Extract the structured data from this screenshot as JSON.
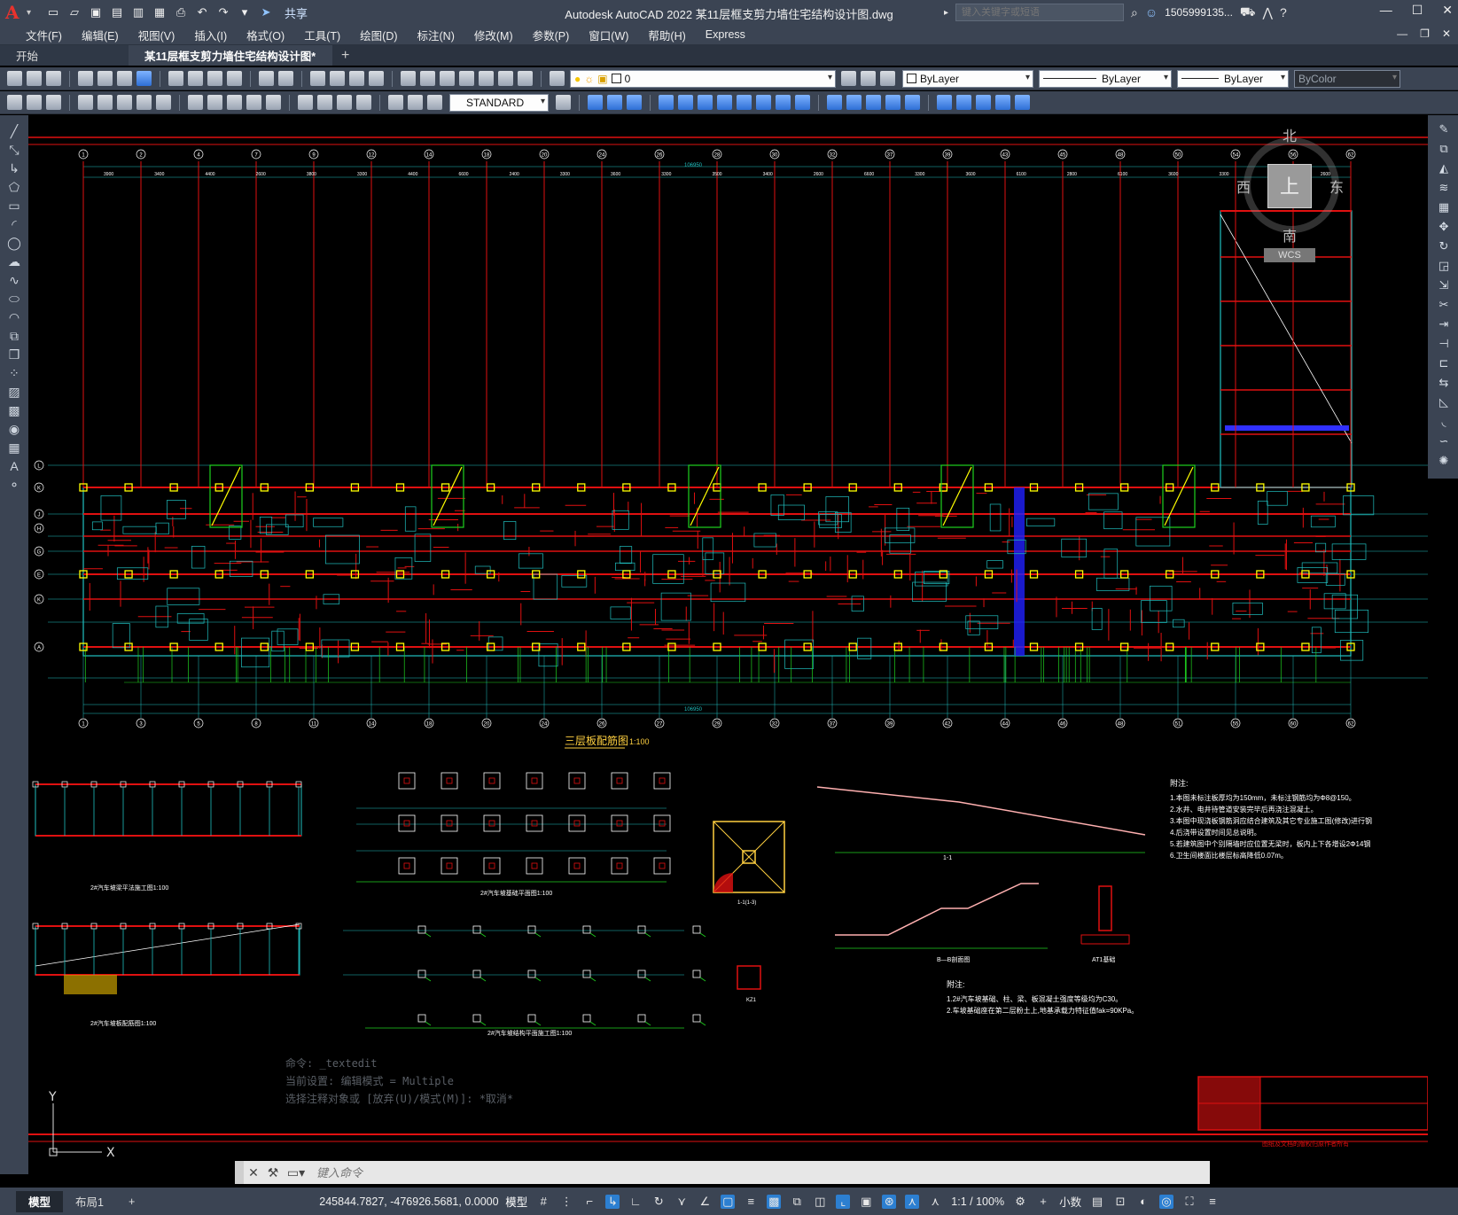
{
  "titlebar": {
    "app_name": "Autodesk AutoCAD 2022",
    "doc_name": "某11层框支剪力墙住宅结构设计图.dwg",
    "title_full": "Autodesk AutoCAD 2022    某11层框支剪力墙住宅结构设计图.dwg",
    "share_label": "共享",
    "search_placeholder": "键入关键字或短语",
    "user_name": "1505999135..."
  },
  "menu": [
    "文件(F)",
    "编辑(E)",
    "视图(V)",
    "插入(I)",
    "格式(O)",
    "工具(T)",
    "绘图(D)",
    "标注(N)",
    "修改(M)",
    "参数(P)",
    "窗口(W)",
    "帮助(H)",
    "Express"
  ],
  "tabs": {
    "start": "开始",
    "active": "某11层框支剪力墙住宅结构设计图*",
    "plus": "+"
  },
  "toolbar": {
    "layer_value": "0",
    "color_value": "ByLayer",
    "linetype_value": "ByLayer",
    "lineweight_value": "ByLayer",
    "plotstyle_value": "ByColor",
    "textstyle_value": "STANDARD"
  },
  "viewcube": {
    "north": "北",
    "south": "南",
    "east": "东",
    "west": "西",
    "top": "上",
    "wcs": "WCS"
  },
  "drawing": {
    "main_title": "三层板配筋图",
    "main_scale": "1:100",
    "notes_title": "附注:",
    "notes": [
      "1.本图未标注板厚均为150mm，未标注钢筋均为Φ8@150。",
      "2.水井、电井待管道安装完毕后再浇注混凝土。",
      "3.本图中现浇板钢筋洞应结合建筑及其它专业施工图(修改)进行钢",
      "4.后浇带设置时间见总说明。",
      "5.若建筑图中个别隔墙时应位置无梁时，板内上下各增设2Φ14钢",
      "6.卫生间楼面比楼层标高降低0.07m。"
    ],
    "notes2_title": "附注:",
    "notes2": [
      "1.2#汽车坡基础、柱、梁、板混凝土强度等级均为C30。",
      "2.车坡基础座在第二层粉土上,地基承载力特征值fak=90KPa。"
    ],
    "sub_labels": [
      "2#汽车坡梁平法施工图1:100",
      "2#汽车坡基础平面图1:100",
      "2#汽车坡板配筋图1:100",
      "2#汽车坡结构平面施工图1:100",
      "1-1",
      "B—B剖面图",
      "AT1基础",
      "KZ1",
      "1-1(1-3)"
    ],
    "axis_top": [
      "1",
      "2",
      "4",
      "7",
      "9",
      "12",
      "14",
      "18",
      "20",
      "24",
      "26",
      "28",
      "30",
      "32",
      "37",
      "39",
      "43",
      "45",
      "48",
      "50",
      "54",
      "56",
      "62"
    ],
    "axis_left": [
      "L",
      "K",
      "J",
      "H",
      "G",
      "E",
      "K",
      "A"
    ],
    "axis_bottom": [
      "1",
      "3",
      "5",
      "8",
      "11",
      "14",
      "18",
      "20",
      "24",
      "26",
      "27",
      "29",
      "32",
      "37",
      "39",
      "42",
      "44",
      "46",
      "48",
      "51",
      "55",
      "60",
      "62"
    ],
    "dim_top": [
      "3900",
      "3400",
      "4400",
      "2600",
      "3800",
      "3300",
      "4400",
      "6600",
      "2400",
      "3300",
      "3600",
      "3300",
      "3500",
      "3400",
      "2600",
      "6600",
      "3300",
      "3600",
      "6100",
      "2800",
      "6100",
      "3600",
      "3300",
      "3900",
      "2600"
    ],
    "dim_overall": "106950",
    "title_block_warning": "图纸及文档的版权归原作者所有"
  },
  "command_history": [
    "命令: _textedit",
    "当前设置: 编辑模式 = Multiple",
    "选择注释对象或 [放弃(U)/模式(M)]: *取消*"
  ],
  "command_placeholder": "键入命令",
  "status": {
    "tab_model": "模型",
    "tab_layout1": "布局1",
    "tab_plus": "+",
    "coords": "245844.7827, -476926.5681, 0.0000",
    "model_label": "模型",
    "scale": "1:1 / 100%",
    "units": "小数"
  },
  "colors": {
    "canvas_bg": "#000000",
    "ui_bg": "#3b4453",
    "beam_red": "#e01010",
    "grid_cyan": "#20c0c0",
    "dim_green": "#1fd11f",
    "column_yellow": "#ffff00",
    "text_white": "#ffffff"
  }
}
